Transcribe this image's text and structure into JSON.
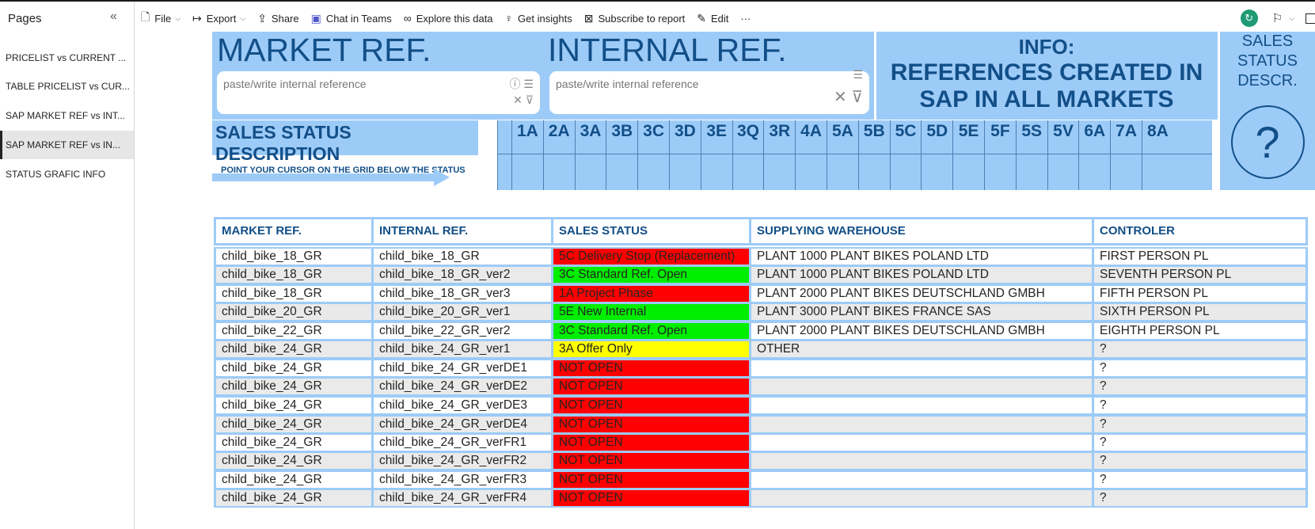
{
  "pages_panel": {
    "title": "Pages",
    "items": [
      {
        "label": "PRICELIST vs CURRENT ..."
      },
      {
        "label": "TABLE PRICELIST vs CUR..."
      },
      {
        "label": "SAP MARKET REF vs INT..."
      },
      {
        "label": "SAP MARKET REF vs IN..."
      },
      {
        "label": "STATUS GRAFIC INFO"
      }
    ],
    "active_index": 3
  },
  "toolbar": {
    "file": "File",
    "export": "Export",
    "share": "Share",
    "chat": "Chat in Teams",
    "explore": "Explore this data",
    "insights": "Get insights",
    "subscribe": "Subscribe to report",
    "edit": "Edit",
    "more": "···"
  },
  "report": {
    "market_title": "MARKET REF.",
    "internal_title": "INTERNAL REF.",
    "market_placeholder": "paste/write internal reference",
    "internal_placeholder": "paste/write internal reference",
    "info_line1": "INFO:",
    "info_line2": "REFERENCES CREATED IN",
    "info_line3": "SAP IN ALL MARKETS",
    "sales_status_descr": [
      "SALES",
      "STATUS",
      "DESCR."
    ],
    "qmark": "?",
    "ssd_title": "SALES STATUS DESCRIPTION",
    "ssd_sub": "POINT YOUR CURSOR ON THE GRID BELOW THE STATUS",
    "status_codes": [
      "1A",
      "2A",
      "3A",
      "3B",
      "3C",
      "3D",
      "3E",
      "3Q",
      "3R",
      "4A",
      "5A",
      "5B",
      "5C",
      "5D",
      "5E",
      "5F",
      "5S",
      "5V",
      "6A",
      "7A",
      "8A"
    ]
  },
  "table": {
    "headers": [
      "MARKET REF.",
      "INTERNAL REF.",
      "SALES STATUS",
      "SUPPLYING WAREHOUSE",
      "CONTROLER"
    ],
    "rows": [
      {
        "market": "child_bike_18_GR",
        "internal": "child_bike_18_GR",
        "status": "5C Delivery Stop (Replacement)",
        "status_color": "#ff0000",
        "warehouse": "PLANT 1000  PLANT BIKES POLAND LTD",
        "controler": "FIRST PERSON PL"
      },
      {
        "market": "child_bike_18_GR",
        "internal": "child_bike_18_GR_ver2",
        "status": "3C Standard Ref. Open",
        "status_color": "#00ee00",
        "warehouse": "PLANT 1000  PLANT BIKES POLAND LTD",
        "controler": "SEVENTH PERSON PL"
      },
      {
        "market": "child_bike_18_GR",
        "internal": "child_bike_18_GR_ver3",
        "status": "1A Project Phase",
        "status_color": "#ff0000",
        "warehouse": "PLANT 2000  PLANT BIKES DEUTSCHLAND GMBH",
        "controler": "FIFTH PERSON PL"
      },
      {
        "market": "child_bike_20_GR",
        "internal": "child_bike_20_GR_ver1",
        "status": "5E New Internal",
        "status_color": "#00ee00",
        "warehouse": "PLANT 3000  PLANT BIKES FRANCE SAS",
        "controler": "SIXTH PERSON PL"
      },
      {
        "market": "child_bike_22_GR",
        "internal": "child_bike_22_GR_ver2",
        "status": "3C Standard Ref. Open",
        "status_color": "#00ee00",
        "warehouse": "PLANT 2000  PLANT BIKES DEUTSCHLAND GMBH",
        "controler": "EIGHTH PERSON PL"
      },
      {
        "market": "child_bike_24_GR",
        "internal": "child_bike_24_GR_ver1",
        "status": "3A Offer Only",
        "status_color": "#ffff00",
        "warehouse": "OTHER",
        "controler": "?"
      },
      {
        "market": "child_bike_24_GR",
        "internal": "child_bike_24_GR_verDE1",
        "status": "NOT OPEN",
        "status_color": "#ff0000",
        "warehouse": "",
        "controler": "?"
      },
      {
        "market": "child_bike_24_GR",
        "internal": "child_bike_24_GR_verDE2",
        "status": "NOT OPEN",
        "status_color": "#ff0000",
        "warehouse": "",
        "controler": "?"
      },
      {
        "market": "child_bike_24_GR",
        "internal": "child_bike_24_GR_verDE3",
        "status": "NOT OPEN",
        "status_color": "#ff0000",
        "warehouse": "",
        "controler": "?"
      },
      {
        "market": "child_bike_24_GR",
        "internal": "child_bike_24_GR_verDE4",
        "status": "NOT OPEN",
        "status_color": "#ff0000",
        "warehouse": "",
        "controler": "?"
      },
      {
        "market": "child_bike_24_GR",
        "internal": "child_bike_24_GR_verFR1",
        "status": "NOT OPEN",
        "status_color": "#ff0000",
        "warehouse": "",
        "controler": "?"
      },
      {
        "market": "child_bike_24_GR",
        "internal": "child_bike_24_GR_verFR2",
        "status": "NOT OPEN",
        "status_color": "#ff0000",
        "warehouse": "",
        "controler": "?"
      },
      {
        "market": "child_bike_24_GR",
        "internal": "child_bike_24_GR_verFR3",
        "status": "NOT OPEN",
        "status_color": "#ff0000",
        "warehouse": "",
        "controler": "?"
      },
      {
        "market": "child_bike_24_GR",
        "internal": "child_bike_24_GR_verFR4",
        "status": "NOT OPEN",
        "status_color": "#ff0000",
        "warehouse": "",
        "controler": "?"
      }
    ]
  }
}
